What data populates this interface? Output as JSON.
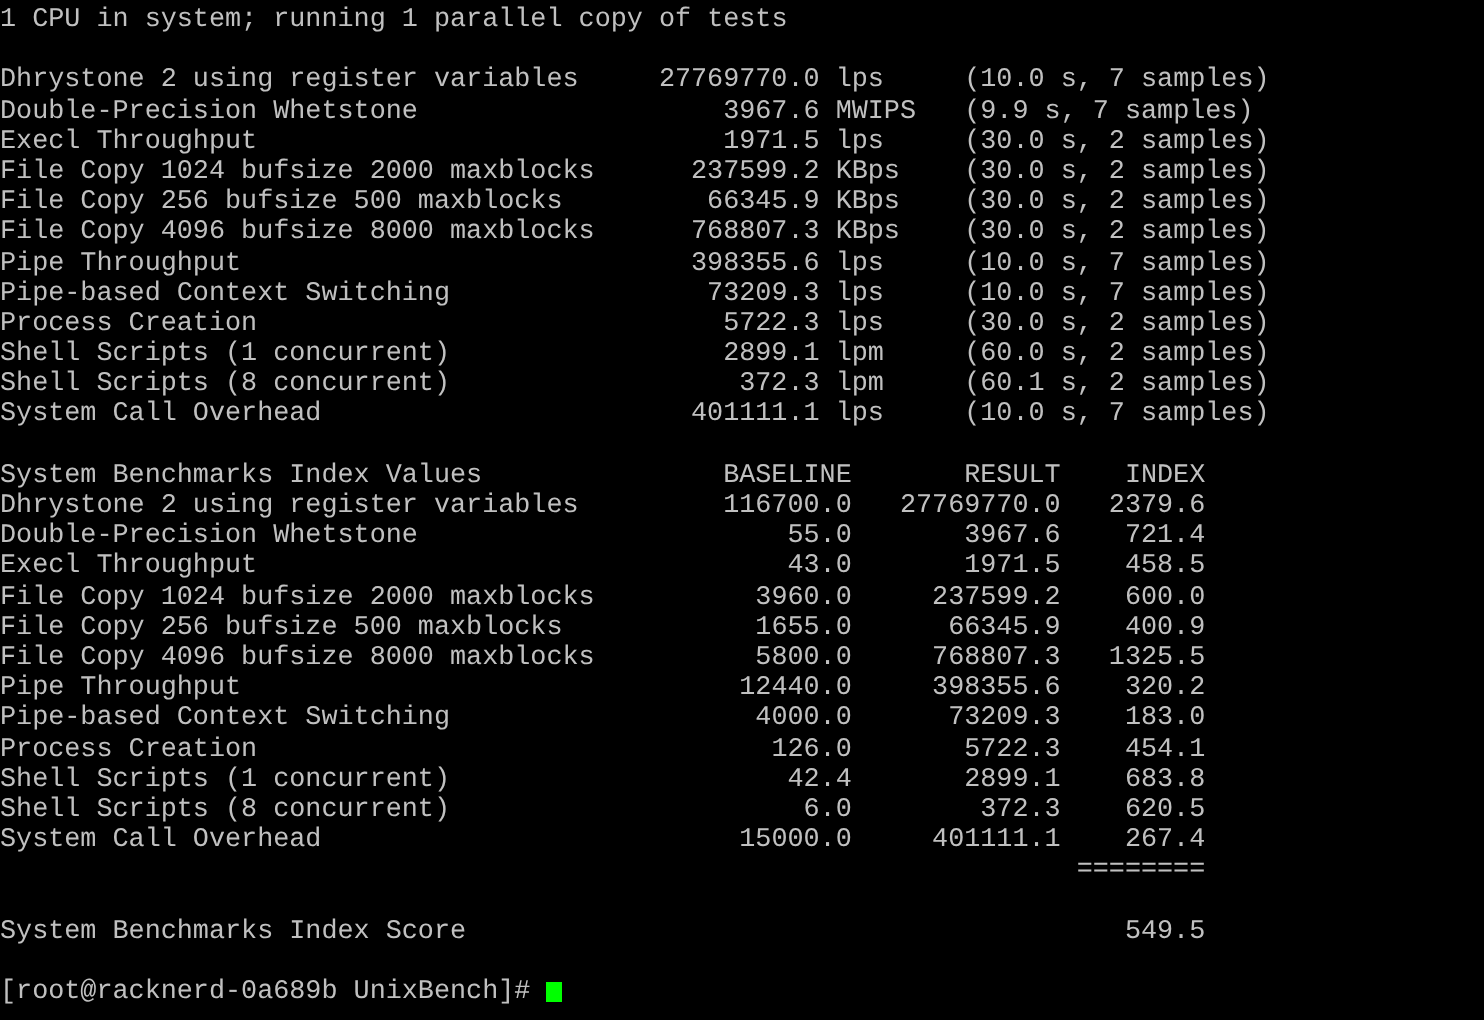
{
  "header_line": "1 CPU in system; running 1 parallel copy of tests",
  "results": [
    {
      "name": "Dhrystone 2 using register variables",
      "value": "27769770.0",
      "unit": "lps",
      "detail": "(10.0 s, 7 samples)"
    },
    {
      "name": "Double-Precision Whetstone",
      "value": "3967.6",
      "unit": "MWIPS",
      "detail": "(9.9 s, 7 samples)"
    },
    {
      "name": "Execl Throughput",
      "value": "1971.5",
      "unit": "lps",
      "detail": "(30.0 s, 2 samples)"
    },
    {
      "name": "File Copy 1024 bufsize 2000 maxblocks",
      "value": "237599.2",
      "unit": "KBps",
      "detail": "(30.0 s, 2 samples)"
    },
    {
      "name": "File Copy 256 bufsize 500 maxblocks",
      "value": "66345.9",
      "unit": "KBps",
      "detail": "(30.0 s, 2 samples)"
    },
    {
      "name": "File Copy 4096 bufsize 8000 maxblocks",
      "value": "768807.3",
      "unit": "KBps",
      "detail": "(30.0 s, 2 samples)"
    },
    {
      "name": "Pipe Throughput",
      "value": "398355.6",
      "unit": "lps",
      "detail": "(10.0 s, 7 samples)"
    },
    {
      "name": "Pipe-based Context Switching",
      "value": "73209.3",
      "unit": "lps",
      "detail": "(10.0 s, 7 samples)"
    },
    {
      "name": "Process Creation",
      "value": "5722.3",
      "unit": "lps",
      "detail": "(30.0 s, 2 samples)"
    },
    {
      "name": "Shell Scripts (1 concurrent)",
      "value": "2899.1",
      "unit": "lpm",
      "detail": "(60.0 s, 2 samples)"
    },
    {
      "name": "Shell Scripts (8 concurrent)",
      "value": "372.3",
      "unit": "lpm",
      "detail": "(60.1 s, 2 samples)"
    },
    {
      "name": "System Call Overhead",
      "value": "401111.1",
      "unit": "lps",
      "detail": "(10.0 s, 7 samples)"
    }
  ],
  "index": {
    "title": "System Benchmarks Index Values",
    "columns": [
      "BASELINE",
      "RESULT",
      "INDEX"
    ],
    "rows": [
      {
        "name": "Dhrystone 2 using register variables",
        "baseline": "116700.0",
        "result": "27769770.0",
        "index": "2379.6"
      },
      {
        "name": "Double-Precision Whetstone",
        "baseline": "55.0",
        "result": "3967.6",
        "index": "721.4"
      },
      {
        "name": "Execl Throughput",
        "baseline": "43.0",
        "result": "1971.5",
        "index": "458.5"
      },
      {
        "name": "File Copy 1024 bufsize 2000 maxblocks",
        "baseline": "3960.0",
        "result": "237599.2",
        "index": "600.0"
      },
      {
        "name": "File Copy 256 bufsize 500 maxblocks",
        "baseline": "1655.0",
        "result": "66345.9",
        "index": "400.9"
      },
      {
        "name": "File Copy 4096 bufsize 8000 maxblocks",
        "baseline": "5800.0",
        "result": "768807.3",
        "index": "1325.5"
      },
      {
        "name": "Pipe Throughput",
        "baseline": "12440.0",
        "result": "398355.6",
        "index": "320.2"
      },
      {
        "name": "Pipe-based Context Switching",
        "baseline": "4000.0",
        "result": "73209.3",
        "index": "183.0"
      },
      {
        "name": "Process Creation",
        "baseline": "126.0",
        "result": "5722.3",
        "index": "454.1"
      },
      {
        "name": "Shell Scripts (1 concurrent)",
        "baseline": "42.4",
        "result": "2899.1",
        "index": "683.8"
      },
      {
        "name": "Shell Scripts (8 concurrent)",
        "baseline": "6.0",
        "result": "372.3",
        "index": "620.5"
      },
      {
        "name": "System Call Overhead",
        "baseline": "15000.0",
        "result": "401111.1",
        "index": "267.4"
      }
    ],
    "rule": "========",
    "score_label": "System Benchmarks Index Score",
    "score": "549.5"
  },
  "prompt": "[root@racknerd-0a689b UnixBench]#"
}
